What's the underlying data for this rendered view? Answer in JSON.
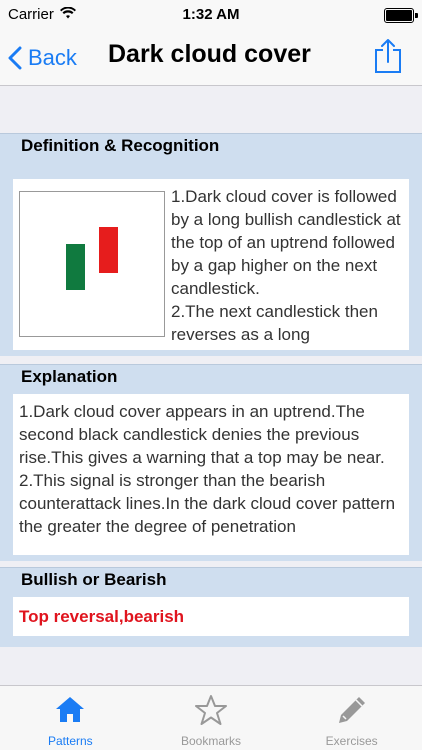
{
  "status_bar": {
    "carrier": "Carrier",
    "time": "1:32 AM"
  },
  "nav": {
    "back_label": "Back",
    "title": "Dark cloud cover"
  },
  "sections": {
    "definition": {
      "header": "Definition & Recognition",
      "text": "1.Dark cloud cover is followed by a long bullish candlestick at the top of an uptrend followed by a gap higher on the next candlestick.\n2.The next candlestick then reverses as a long"
    },
    "explanation": {
      "header": "Explanation",
      "text": "1.Dark cloud cover appears in an uptrend.The second black candlestick denies the previous rise.This gives a warning that a top may be near.\n2.This signal is stronger than the bearish counterattack lines.In the dark cloud cover pattern the greater the degree of penetration"
    },
    "bullish_bearish": {
      "header": "Bullish or Bearish",
      "text": "Top reversal,bearish"
    }
  },
  "tabs": [
    {
      "label": "Patterns",
      "icon": "house-icon",
      "active": true
    },
    {
      "label": "Bookmarks",
      "icon": "star-icon",
      "active": false
    },
    {
      "label": "Exercises",
      "icon": "pencil-icon",
      "active": false
    }
  ],
  "colors": {
    "accent": "#1a7cf4",
    "section_bg": "#cfdeef",
    "bearish_text": "#e0141e",
    "candle_green": "#107a3f",
    "candle_red": "#e61d1d"
  }
}
